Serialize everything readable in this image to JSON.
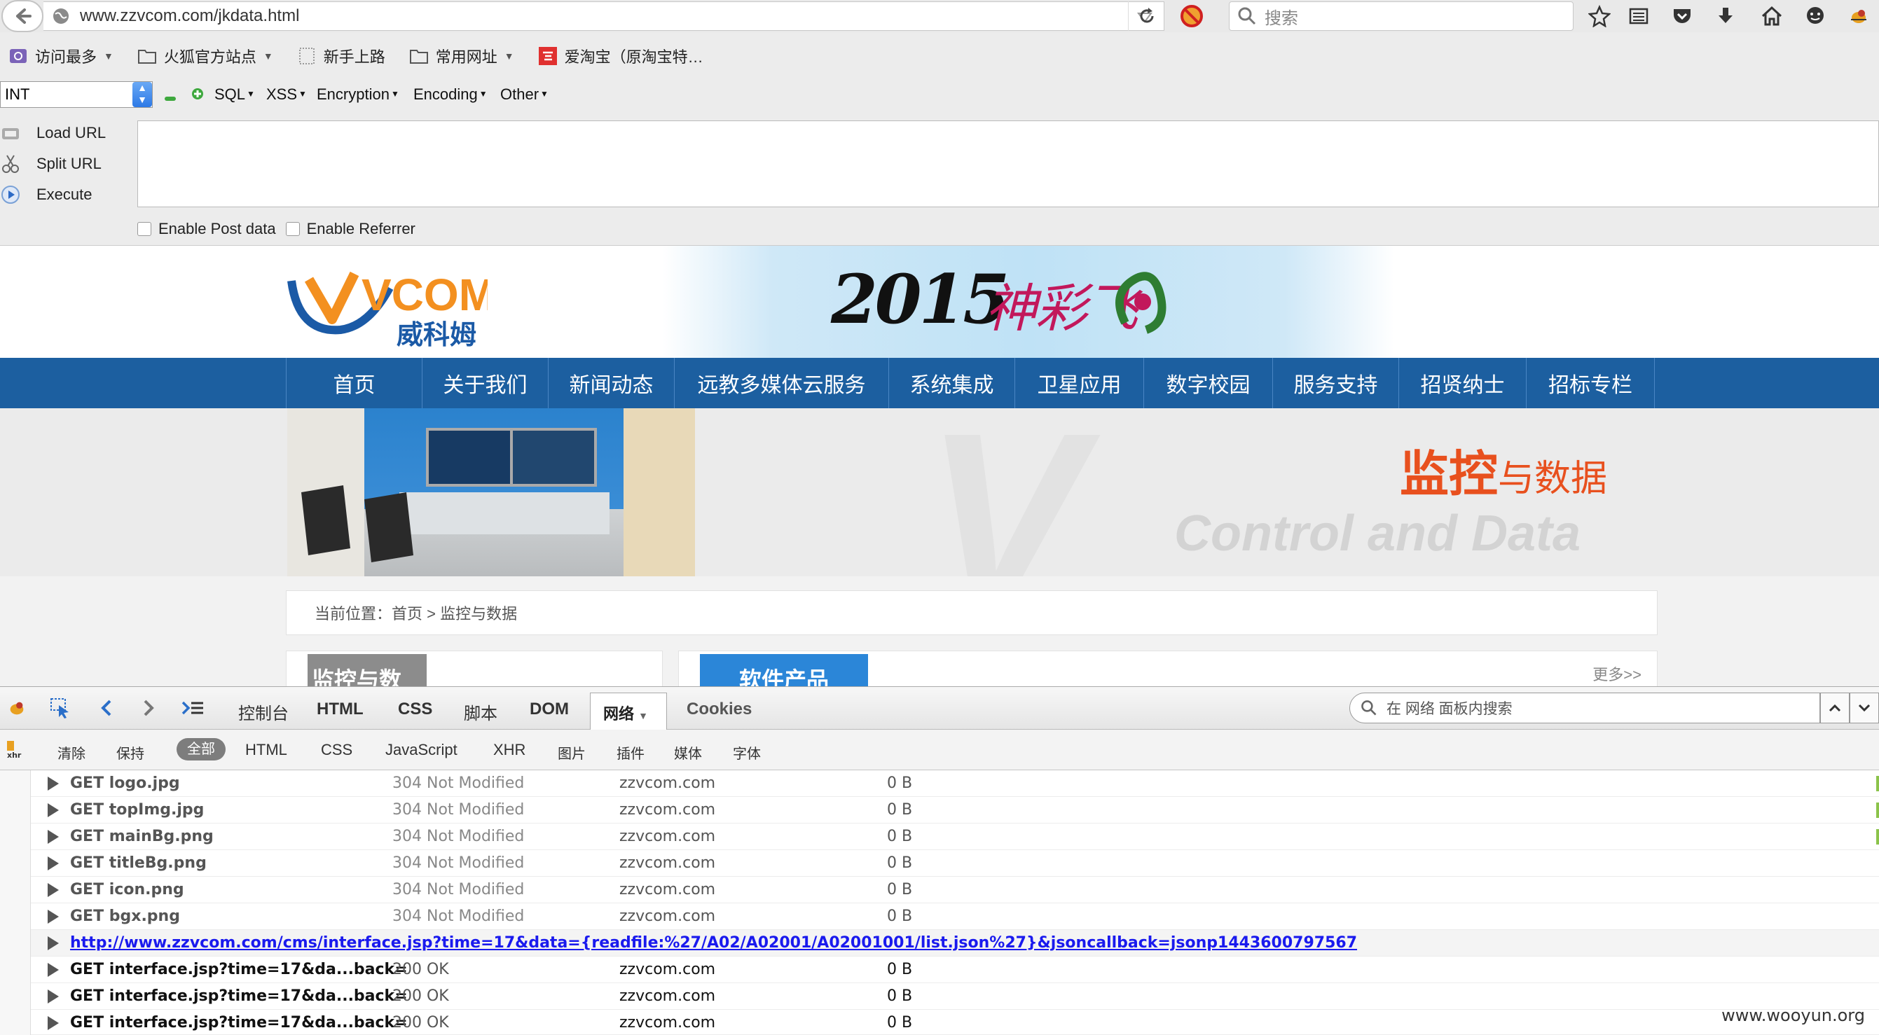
{
  "browser": {
    "url": "www.zzvcom.com/jkdata.html",
    "search_placeholder": "搜索"
  },
  "bookmarks": [
    {
      "label": "访问最多",
      "icon": "gear-folder-icon",
      "dropdown": true
    },
    {
      "label": "火狐官方站点",
      "icon": "folder-icon",
      "dropdown": true
    },
    {
      "label": "新手上路",
      "icon": "dotted-page-icon",
      "dropdown": false
    },
    {
      "label": "常用网址",
      "icon": "folder-icon",
      "dropdown": true
    },
    {
      "label": "爱淘宝（原淘宝特…",
      "icon": "taobao-icon",
      "dropdown": false
    }
  ],
  "hackbar": {
    "select_value": "INT",
    "menus": [
      "SQL",
      "XSS",
      "Encryption",
      "Encoding",
      "Other"
    ],
    "buttons": [
      "Load URL",
      "Split URL",
      "Execute"
    ],
    "options": [
      "Enable Post data",
      "Enable Referrer"
    ]
  },
  "site": {
    "logo_text": "VCOM",
    "logo_cn": "威科姆",
    "banner_year": "2015",
    "banner_cn": "神彩飞",
    "nav": [
      "首页",
      "关于我们",
      "新闻动态",
      "远教多媒体云服务",
      "系统集成",
      "卫星应用",
      "数字校园",
      "服务支持",
      "招贤纳士",
      "招标专栏"
    ],
    "hero_title_main": "监控",
    "hero_title_rest": "与数据",
    "hero_en": "Control and Data",
    "breadcrumb": "当前位置：首页 > 监控与数据",
    "side_title": "监控与数据",
    "main_title": "软件产品",
    "more": "更多>>"
  },
  "devtools": {
    "tabs": [
      "控制台",
      "HTML",
      "CSS",
      "脚本",
      "DOM",
      "网络",
      "Cookies"
    ],
    "search_placeholder": "在 网络 面板内搜索",
    "filters": [
      "清除",
      "保持",
      "全部",
      "HTML",
      "CSS",
      "JavaScript",
      "XHR",
      "图片",
      "插件",
      "媒体",
      "字体"
    ],
    "requests": [
      {
        "name": "GET logo.jpg",
        "status": "304 Not Modified",
        "domain": "zzvcom.com",
        "size": "0 B",
        "dark": false
      },
      {
        "name": "GET topImg.jpg",
        "status": "304 Not Modified",
        "domain": "zzvcom.com",
        "size": "0 B",
        "dark": false
      },
      {
        "name": "GET mainBg.png",
        "status": "304 Not Modified",
        "domain": "zzvcom.com",
        "size": "0 B",
        "dark": false
      },
      {
        "name": "GET titleBg.png",
        "status": "304 Not Modified",
        "domain": "zzvcom.com",
        "size": "0 B",
        "dark": false
      },
      {
        "name": "GET icon.png",
        "status": "304 Not Modified",
        "domain": "zzvcom.com",
        "size": "0 B",
        "dark": false
      },
      {
        "name": "GET bgx.png",
        "status": "304 Not Modified",
        "domain": "zzvcom.com",
        "size": "0 B",
        "dark": false
      }
    ],
    "expanded_url": "http://www.zzvcom.com/cms/interface.jsp?time=17&data={readfile:%27/A02/A02001/A02001001/list.json%27}&jsoncallback=jsonp1443600797567",
    "requests2": [
      {
        "name": "GET interface.jsp?time=17&da...back=",
        "status": "200 OK",
        "domain": "zzvcom.com",
        "size": "0 B"
      },
      {
        "name": "GET interface.jsp?time=17&da...back=",
        "status": "200 OK",
        "domain": "zzvcom.com",
        "size": "0 B"
      },
      {
        "name": "GET interface.jsp?time=17&da...back=",
        "status": "200 OK",
        "domain": "zzvcom.com",
        "size": "0 B"
      }
    ]
  },
  "watermark": "www.wooyun.org"
}
